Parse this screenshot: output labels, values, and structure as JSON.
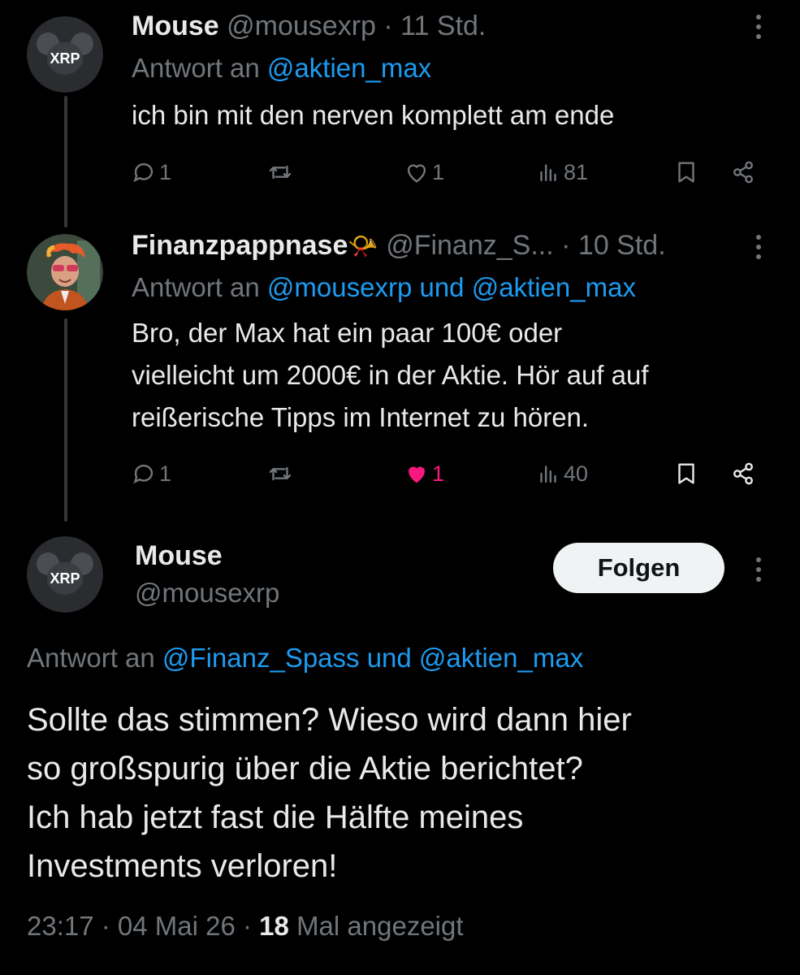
{
  "tweets": [
    {
      "name": "Mouse",
      "handle": "@mousexrp",
      "time": "· 11 Std.",
      "reply_prefix": "Antwort an",
      "reply_to": "@aktien_max",
      "text": "ich bin mit den nerven komplett am ende",
      "avatar_label": "XRP",
      "stats": {
        "replies": "1",
        "likes": "1",
        "views": "81"
      },
      "liked": false
    },
    {
      "name": "Finanzpappnase",
      "name_emoji": "📯",
      "handle": "@Finanz_S...",
      "time": "· 10 Std.",
      "reply_prefix": "Antwort an",
      "reply_to": "@mousexrp und @aktien_max",
      "text_lines": [
        "Bro, der Max hat ein paar 100€ oder",
        "vielleicht um 2000€ in der Aktie. Hör auf auf",
        "reißerische Tipps im Internet zu hören."
      ],
      "stats": {
        "replies": "1",
        "likes": "1",
        "views": "40"
      },
      "liked": true
    }
  ],
  "main_tweet": {
    "name": "Mouse",
    "handle": "@mousexrp",
    "avatar_label": "XRP",
    "follow_label": "Folgen",
    "reply_prefix": "Antwort an",
    "reply_to": "@Finanz_Spass und @aktien_max",
    "text_lines": [
      "Sollte das stimmen? Wieso wird dann hier",
      "so großspurig über die Aktie berichtet?",
      "Ich hab jetzt fast die Hälfte meines",
      "Investments verloren!"
    ],
    "timestamp": "23:17 · 04 Mai 26 ·",
    "views_count": "18",
    "views_label": "Mal angezeigt"
  },
  "colors": {
    "background": "#000000",
    "text": "#e7e9ea",
    "muted": "#71767b",
    "link": "#1d9bf0",
    "like": "#f91880"
  }
}
